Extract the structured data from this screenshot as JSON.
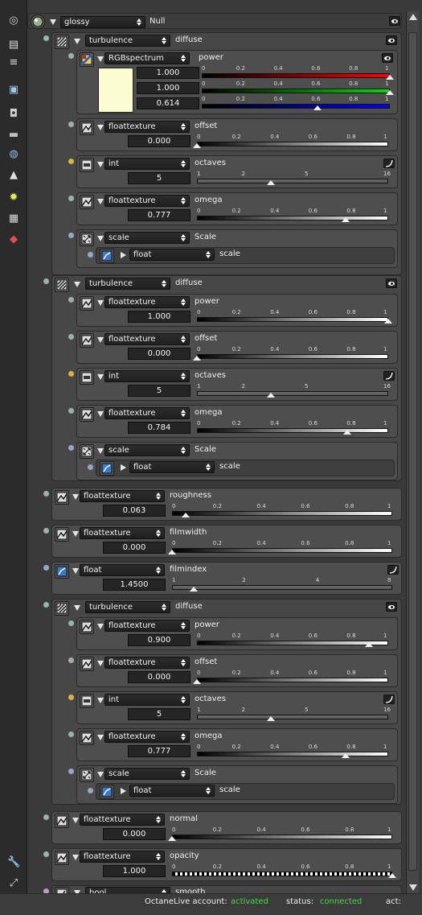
{
  "header": {
    "type": "glossy",
    "name": "Null"
  },
  "sections": [
    {
      "type": "turbulence",
      "name": "diffuse",
      "power": {
        "type": "RGBspectrum",
        "name": "power",
        "r": "1.000",
        "g": "1.000",
        "b": "0.614",
        "rv": 1.0,
        "gv": 1.0,
        "bv": 0.614,
        "swatch": "#fcfcd2"
      },
      "offset": {
        "type": "floattexture",
        "name": "offset",
        "value": "0.000",
        "v": 0.0
      },
      "octaves": {
        "type": "int",
        "name": "octaves",
        "value": "5",
        "v": 5
      },
      "omega": {
        "type": "floattexture",
        "name": "omega",
        "value": "0.777",
        "v": 0.777
      },
      "scale": {
        "type": "scale",
        "name": "Scale",
        "sub_type": "float",
        "sub_name": "scale"
      }
    },
    {
      "type": "turbulence",
      "name": "diffuse",
      "power": {
        "type": "floattexture",
        "name": "power",
        "value": "1.000",
        "v": 1.0
      },
      "offset": {
        "type": "floattexture",
        "name": "offset",
        "value": "0.000",
        "v": 0.0
      },
      "octaves": {
        "type": "int",
        "name": "octaves",
        "value": "5",
        "v": 5
      },
      "omega": {
        "type": "floattexture",
        "name": "omega",
        "value": "0.784",
        "v": 0.784
      },
      "scale": {
        "type": "scale",
        "name": "Scale",
        "sub_type": "float",
        "sub_name": "scale"
      }
    },
    {
      "type": "turbulence",
      "name": "diffuse",
      "power": {
        "type": "floattexture",
        "name": "power",
        "value": "0.900",
        "v": 0.9
      },
      "offset": {
        "type": "floattexture",
        "name": "offset",
        "value": "0.000",
        "v": 0.0
      },
      "octaves": {
        "type": "int",
        "name": "octaves",
        "value": "5",
        "v": 5
      },
      "omega": {
        "type": "floattexture",
        "name": "omega",
        "value": "0.777",
        "v": 0.777
      },
      "scale": {
        "type": "scale",
        "name": "Scale",
        "sub_type": "float",
        "sub_name": "scale"
      }
    }
  ],
  "roughness": {
    "type": "floattexture",
    "name": "roughness",
    "value": "0.063",
    "v": 0.063
  },
  "filmwidth": {
    "type": "floattexture",
    "name": "filmwidth",
    "value": "0.000",
    "v": 0.0
  },
  "filmindex": {
    "type": "float",
    "name": "filmindex",
    "value": "1.4500",
    "v": 1.45
  },
  "normal": {
    "type": "floattexture",
    "name": "normal",
    "value": "0.000",
    "v": 0.0
  },
  "opacity": {
    "type": "floattexture",
    "name": "opacity",
    "value": "1.000",
    "v": 1.0
  },
  "smooth": {
    "type": "bool",
    "name": "smooth"
  },
  "ticks01": [
    "0",
    "0.2",
    "0.4",
    "0.6",
    "0.8",
    "1"
  ],
  "ticks116": [
    "1",
    "2",
    "5",
    "16"
  ],
  "ticks18": [
    "1",
    "2",
    "4",
    "8"
  ],
  "status": {
    "account_label": "OctaneLive account:",
    "account_value": "activated",
    "status_label": "status:",
    "status_value": "connected",
    "act_label": "act:"
  },
  "colors": {
    "pin_green": "#9bb4a8",
    "pin_yellow": "#d8b43a",
    "pin_blue": "#9aa6c8",
    "ok": "#3fdc3f"
  },
  "icons": [
    "render-icon",
    "layers-icon",
    "list-icon",
    "image-icon",
    "camera-icon",
    "strip-icon",
    "database-icon",
    "landscape-icon",
    "sun-icon",
    "grid-icon",
    "shapes-icon",
    "wrench-icon",
    "expand-icon"
  ]
}
